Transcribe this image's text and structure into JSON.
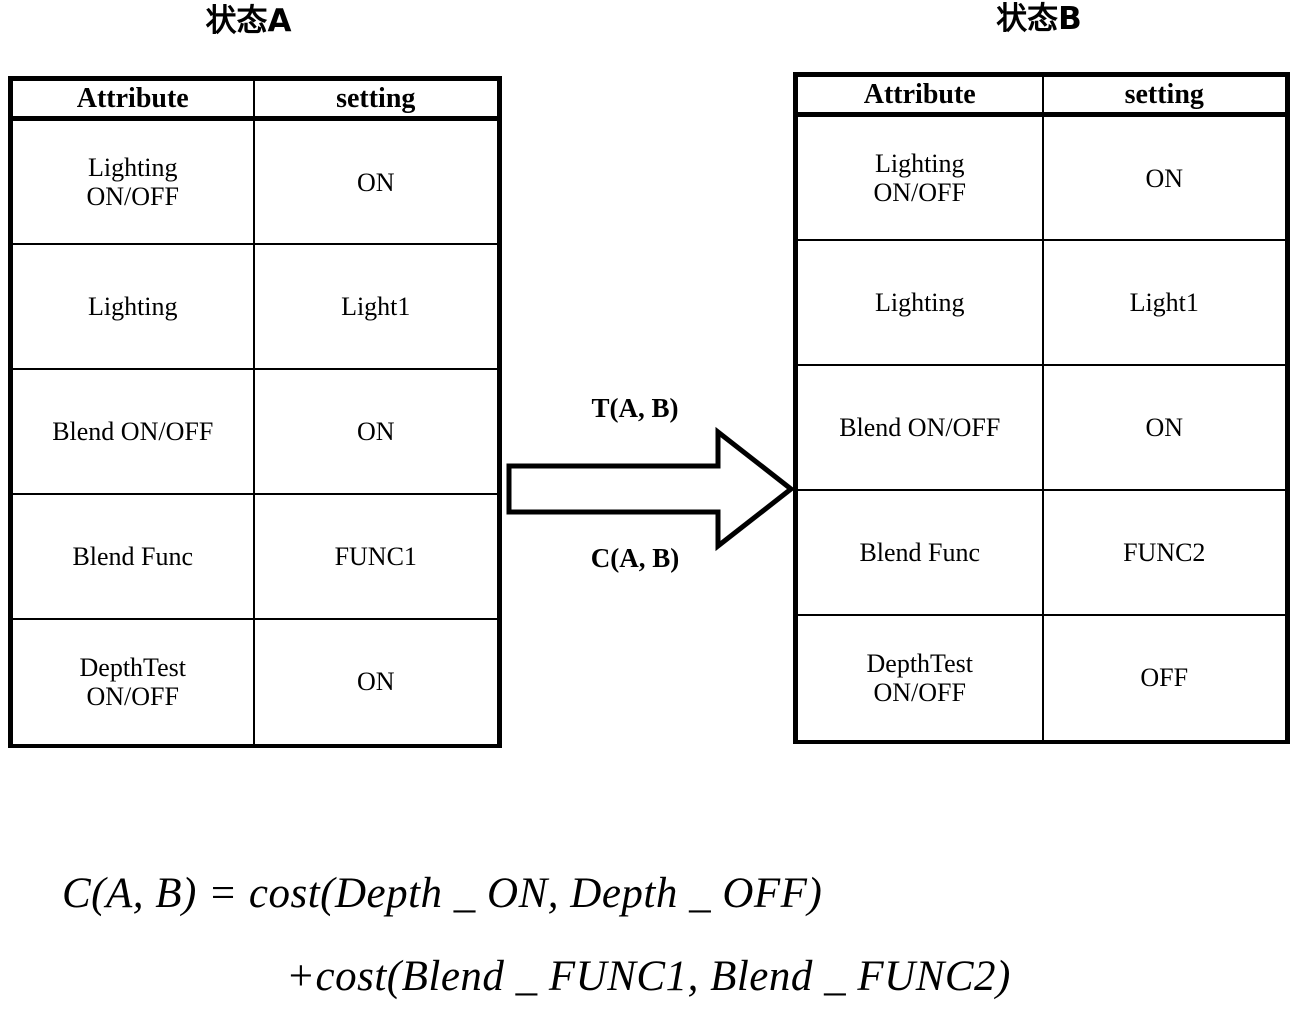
{
  "figure": {
    "left_state_title": "状态A",
    "right_state_title": "状态B"
  },
  "table_a": {
    "headers": [
      "Attribute",
      "setting"
    ],
    "rows": [
      {
        "attribute": "Lighting\nON/OFF",
        "setting": "ON"
      },
      {
        "attribute": "Lighting",
        "setting": "Light1"
      },
      {
        "attribute": "Blend ON/OFF",
        "setting": "ON"
      },
      {
        "attribute": "Blend Func",
        "setting": "FUNC1"
      },
      {
        "attribute": "DepthTest\nON/OFF",
        "setting": "ON"
      }
    ]
  },
  "table_b": {
    "headers": [
      "Attribute",
      "setting"
    ],
    "rows": [
      {
        "attribute": "Lighting\nON/OFF",
        "setting": "ON"
      },
      {
        "attribute": "Lighting",
        "setting": "Light1"
      },
      {
        "attribute": "Blend ON/OFF",
        "setting": "ON"
      },
      {
        "attribute": "Blend Func",
        "setting": "FUNC2"
      },
      {
        "attribute": "DepthTest\nON/OFF",
        "setting": "OFF"
      }
    ]
  },
  "transition": {
    "label_above": "T(A, B)",
    "label_below": "C(A, B)",
    "arrow_icon": "right-block-arrow-icon"
  },
  "formula": {
    "line_1": "C(A, B) = cost(Depth _ ON, Depth _ OFF)",
    "line_2": "+cost(Blend _ FUNC1, Blend _ FUNC2)"
  },
  "colors": {
    "ink": "#000000",
    "paper": "#ffffff"
  }
}
